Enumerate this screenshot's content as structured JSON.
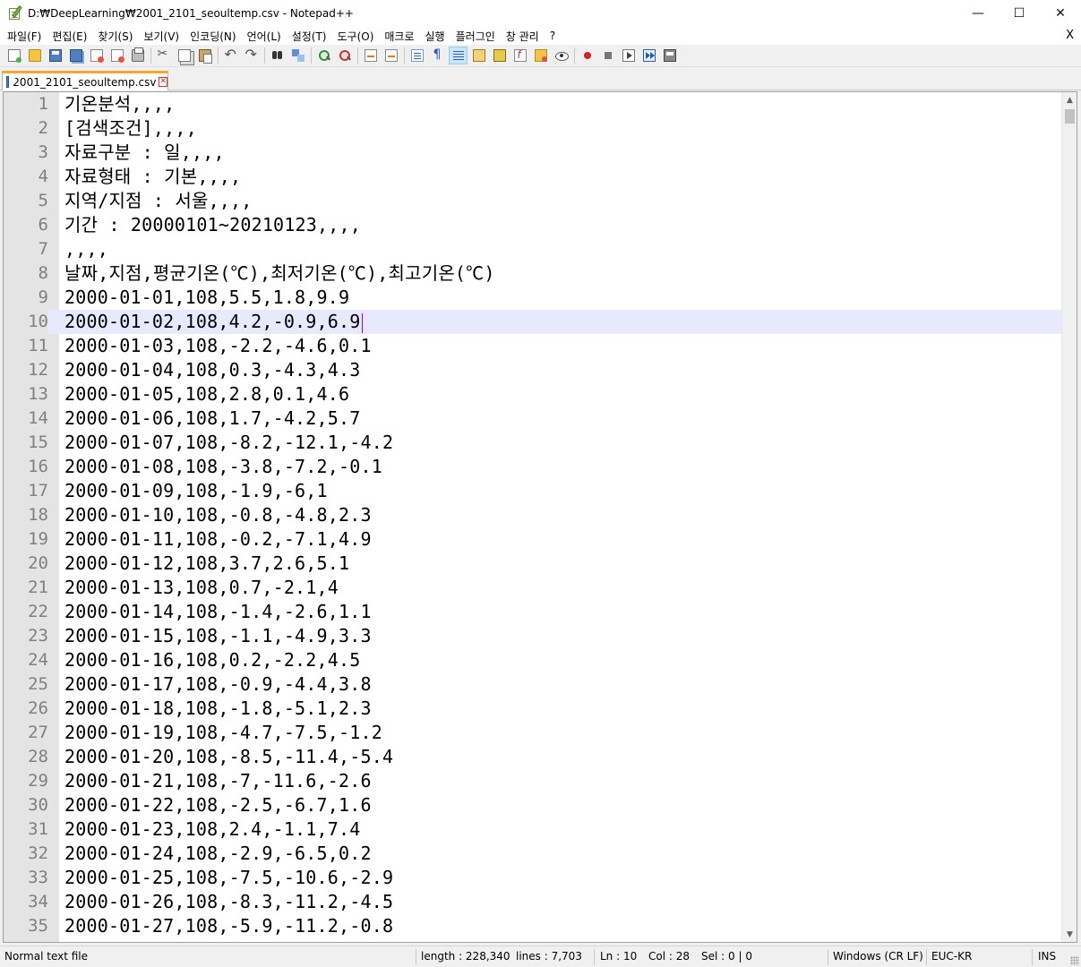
{
  "window": {
    "title": "D:₩DeepLearning₩2001_2101_seoultemp.csv - Notepad++",
    "minimize": "—",
    "maximize": "☐",
    "close": "✕"
  },
  "menu": {
    "items": [
      "파일(F)",
      "편집(E)",
      "찾기(S)",
      "보기(V)",
      "인코딩(N)",
      "언어(L)",
      "설정(T)",
      "도구(O)",
      "매크로",
      "실행",
      "플러그인",
      "창 관리",
      "?"
    ],
    "close": "X"
  },
  "toolbar": {
    "buttons": [
      "new-file-icon",
      "open-file-icon",
      "save-icon",
      "save-all-icon",
      "close-icon",
      "close-all-icon",
      "print-icon",
      "cut-icon",
      "copy-icon",
      "paste-icon",
      "undo-icon",
      "redo-icon",
      "find-icon",
      "replace-icon",
      "zoom-in-icon",
      "zoom-out-icon",
      "sync-vertical-icon",
      "sync-horizontal-icon",
      "word-wrap-icon",
      "show-all-chars-icon",
      "indent-guide-icon",
      "user-language-icon",
      "document-map-icon",
      "function-list-icon",
      "folder-workspace-icon",
      "monitoring-icon",
      "record-macro-icon",
      "stop-record-icon",
      "playback-macro-icon",
      "run-macro-multiple-icon",
      "save-macro-icon"
    ],
    "active_button": "indent-guide-icon"
  },
  "tab": {
    "label": "2001_2101_seoultemp.csv",
    "close": "✕"
  },
  "editor": {
    "current_line": 10,
    "lines": [
      "기온분석,,,,",
      "[검색조건],,,,",
      "자료구분 : 일,,,,",
      "자료형태 : 기본,,,,",
      "지역/지점 : 서울,,,,",
      "기간 : 20000101~20210123,,,,",
      ",,,,",
      "날짜,지점,평균기온(℃),최저기온(℃),최고기온(℃)",
      "2000-01-01,108,5.5,1.8,9.9",
      "2000-01-02,108,4.2,-0.9,6.9",
      "2000-01-03,108,-2.2,-4.6,0.1",
      "2000-01-04,108,0.3,-4.3,4.3",
      "2000-01-05,108,2.8,0.1,4.6",
      "2000-01-06,108,1.7,-4.2,5.7",
      "2000-01-07,108,-8.2,-12.1,-4.2",
      "2000-01-08,108,-3.8,-7.2,-0.1",
      "2000-01-09,108,-1.9,-6,1",
      "2000-01-10,108,-0.8,-4.8,2.3",
      "2000-01-11,108,-0.2,-7.1,4.9",
      "2000-01-12,108,3.7,2.6,5.1",
      "2000-01-13,108,0.7,-2.1,4",
      "2000-01-14,108,-1.4,-2.6,1.1",
      "2000-01-15,108,-1.1,-4.9,3.3",
      "2000-01-16,108,0.2,-2.2,4.5",
      "2000-01-17,108,-0.9,-4.4,3.8",
      "2000-01-18,108,-1.8,-5.1,2.3",
      "2000-01-19,108,-4.7,-7.5,-1.2",
      "2000-01-20,108,-8.5,-11.4,-5.4",
      "2000-01-21,108,-7,-11.6,-2.6",
      "2000-01-22,108,-2.5,-6.7,1.6",
      "2000-01-23,108,2.4,-1.1,7.4",
      "2000-01-24,108,-2.9,-6.5,0.2",
      "2000-01-25,108,-7.5,-10.6,-2.9",
      "2000-01-26,108,-8.3,-11.2,-4.5",
      "2000-01-27,108,-5.9,-11.2,-0.8"
    ]
  },
  "statusbar": {
    "filetype": "Normal text file",
    "length": "length : 228,340",
    "lines": "lines : 7,703",
    "ln": "Ln : 10",
    "col": "Col : 28",
    "sel": "Sel : 0 | 0",
    "eol": "Windows (CR LF)",
    "encoding": "EUC-KR",
    "mode": "INS"
  }
}
